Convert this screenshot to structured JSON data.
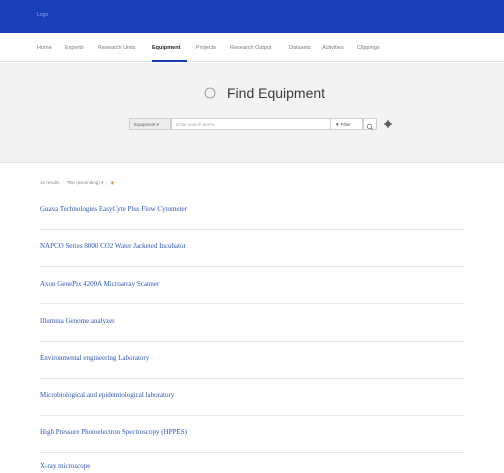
{
  "header": {
    "logo_text": "Logo"
  },
  "nav": {
    "items": [
      {
        "label": "Home"
      },
      {
        "label": "Experts"
      },
      {
        "label": "Research Units"
      },
      {
        "label": "Equipment"
      },
      {
        "label": "Projects"
      },
      {
        "label": "Research Output"
      },
      {
        "label": "Datasets"
      },
      {
        "label": "Activities"
      },
      {
        "label": "Clippings"
      }
    ],
    "active": "Equipment"
  },
  "hero": {
    "title": "Find Equipment"
  },
  "search": {
    "type_label": "Equipment ▾",
    "placeholder": "Enter search terms...",
    "filter_label": "▼ Filter"
  },
  "results": {
    "count_text": "12 results",
    "sort_label": "Title (ascending) ▾",
    "rss_icon": "rss-icon",
    "items": [
      {
        "title": "Guava Technologies EasyCyte Plus Flow Cytometer"
      },
      {
        "title": "NAPCO Series 8000 CO2 Water Jacketed Incubator"
      },
      {
        "title": "Axon GenePix 4200A Microarray Scanner"
      },
      {
        "title": "Illumina Genome analyzer"
      },
      {
        "title": "Environmental engineering Laboratory"
      },
      {
        "title": "Microbiological and epidemiological laboratory"
      },
      {
        "title": "High Pressure Photoelectron Spectroscopy (HPPES)"
      },
      {
        "title": "X-ray microscope"
      }
    ]
  },
  "colors": {
    "brand": "#1a3fb8",
    "link": "#2e55b8"
  }
}
